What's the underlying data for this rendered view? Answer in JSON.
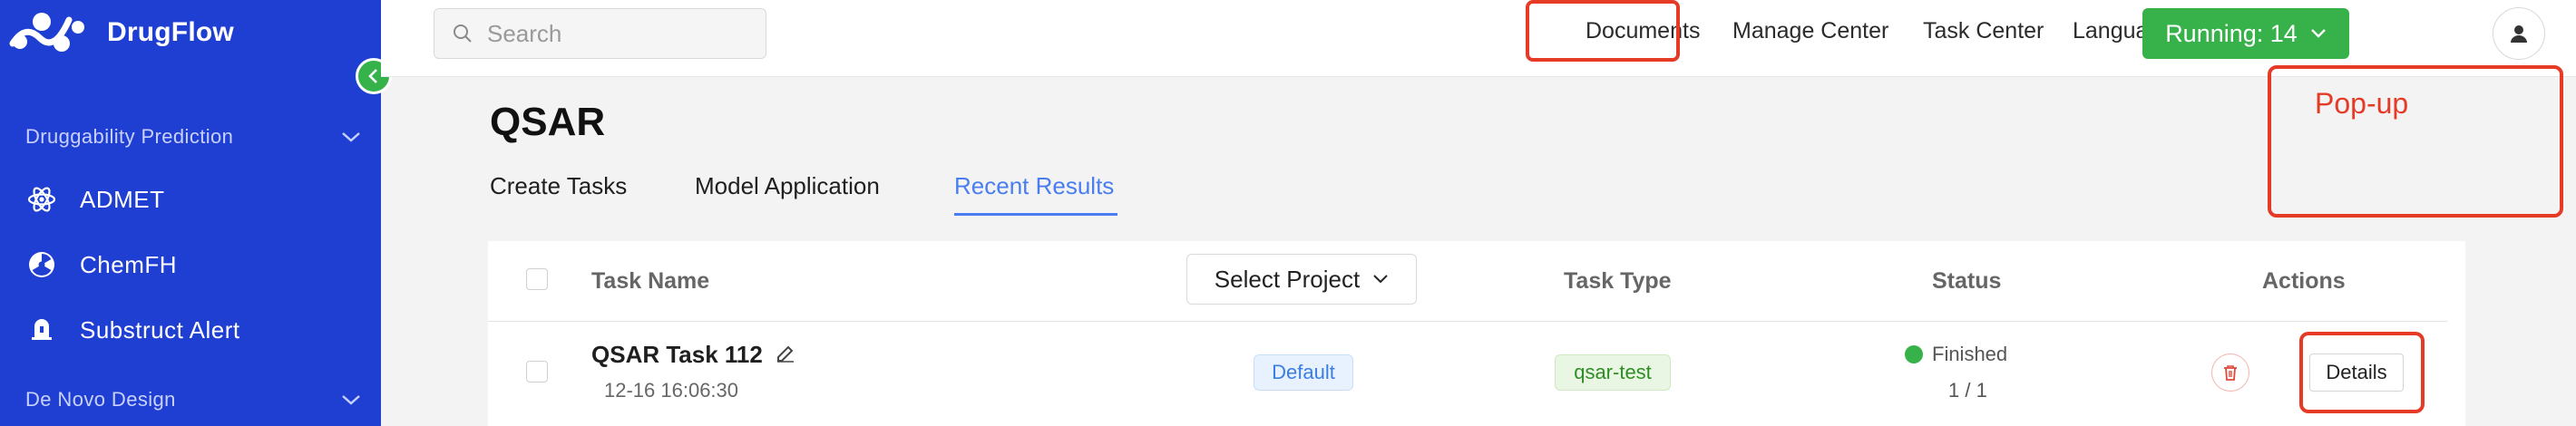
{
  "app": {
    "name": "DrugFlow"
  },
  "sidebar": {
    "sections": [
      {
        "label": "Druggability Prediction"
      },
      {
        "label": "De Novo Design"
      }
    ],
    "items": [
      {
        "label": "ADMET",
        "icon": "atom-icon"
      },
      {
        "label": "ChemFH",
        "icon": "radiation-icon"
      },
      {
        "label": "Substruct Alert",
        "icon": "bell-icon"
      }
    ]
  },
  "topbar": {
    "search_placeholder": "Search",
    "links": [
      "Documents",
      "Manage Center",
      "Task Center"
    ],
    "language_label": "Language",
    "running_label": "Running: 14"
  },
  "annotation": {
    "popup_label": "Pop-up",
    "color": "#e53b26"
  },
  "page": {
    "title": "QSAR",
    "tabs": [
      {
        "label": "Create Tasks",
        "active": false
      },
      {
        "label": "Model Application",
        "active": false
      },
      {
        "label": "Recent Results",
        "active": true
      }
    ]
  },
  "table": {
    "columns": {
      "task_name": "Task Name",
      "project_select": "Select Project",
      "task_type": "Task Type",
      "status": "Status",
      "actions": "Actions"
    },
    "rows": [
      {
        "name": "QSAR Task 112",
        "time": "12-16 16:06:30",
        "project": "Default",
        "type": "qsar-test",
        "status": "Finished",
        "progress": "1 / 1",
        "details_label": "Details"
      }
    ]
  },
  "colors": {
    "sidebar": "#1f3fd3",
    "accent_blue": "#4a7df0",
    "green": "#37b24a",
    "annotation_red": "#e53b26"
  }
}
